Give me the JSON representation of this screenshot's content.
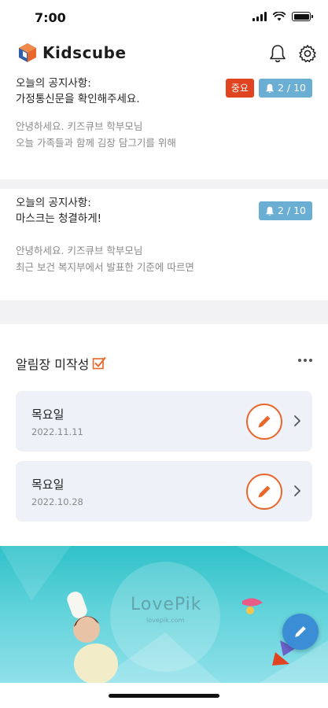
{
  "status_bar": {
    "time": "7:00"
  },
  "app": {
    "name": "Kidscube",
    "brand_color": "#e8672b",
    "accent_color": "#6baed4"
  },
  "header": {
    "icons": [
      "bell-icon",
      "gear-icon"
    ]
  },
  "notices": [
    {
      "title": "오늘의 공지사항:",
      "subject": "가정통신문을 확인해주세요.",
      "badge_important": "중요",
      "count": "2 / 10",
      "body_line1": "안녕하세요. 키즈큐브 학부모님",
      "body_line2": "오늘 가족들과 함께 김장 담그기를 위해"
    },
    {
      "title": "오늘의 공지사항:",
      "subject": "마스크는 청결하게!",
      "count": "2 / 10",
      "body_line1": "안녕하세요. 키즈큐브 학부모님",
      "body_line2": "최근 보건 복지부에서 발표한 기준에 따르면"
    }
  ],
  "unwritten_section": {
    "title": "알림장 미작성",
    "items": [
      {
        "day": "목요일",
        "date": "2022.11.11"
      },
      {
        "day": "목요일",
        "date": "2022.10.28"
      }
    ]
  },
  "banner": {
    "watermark": "LovePik",
    "watermark_sub": "lovepik.com"
  }
}
